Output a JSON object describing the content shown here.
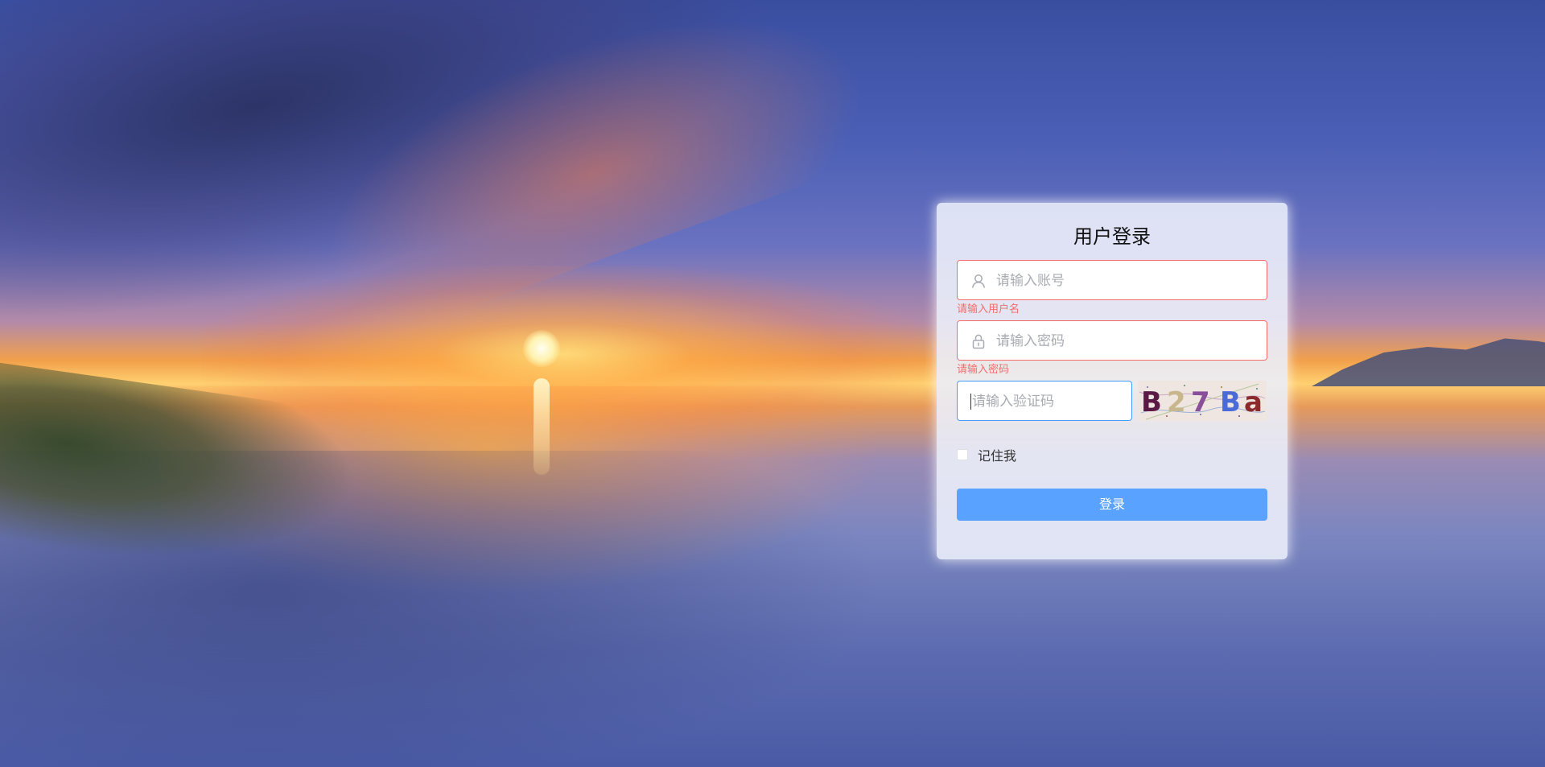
{
  "login": {
    "title": "用户登录",
    "username": {
      "placeholder": "请输入账号",
      "value": "",
      "error": "请输入用户名",
      "icon": "user-icon"
    },
    "password": {
      "placeholder": "请输入密码",
      "value": "",
      "error": "请输入密码",
      "icon": "lock-icon"
    },
    "captcha": {
      "placeholder": "请输入验证码",
      "value": "",
      "image_text": [
        "B",
        "2",
        "7",
        "B",
        "a"
      ],
      "image_colors": [
        "#5b1a45",
        "#c8b78c",
        "#8a4f9a",
        "#4a6ad8",
        "#8a2a2a"
      ]
    },
    "remember": {
      "label": "记住我",
      "checked": false
    },
    "submit_label": "登录"
  },
  "colors": {
    "error": "#f56c6c",
    "focus": "#409eff",
    "primary_button": "#5aa2ff"
  }
}
